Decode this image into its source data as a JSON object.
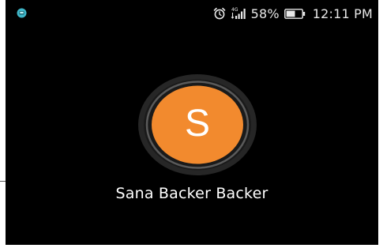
{
  "status_bar": {
    "network_type": "4G",
    "battery_percent": "58%",
    "battery_level": 0.58,
    "time": "12:11 PM",
    "icons": [
      "app-notification-icon",
      "alarm-clock-icon",
      "signal-icon",
      "battery-icon"
    ]
  },
  "contact": {
    "initial": "S",
    "name": "Sana Backer Backer",
    "avatar_color": "#f28a2e"
  },
  "colors": {
    "background": "#000000",
    "ring": "#3a3a3a",
    "text": "#ffffff"
  }
}
